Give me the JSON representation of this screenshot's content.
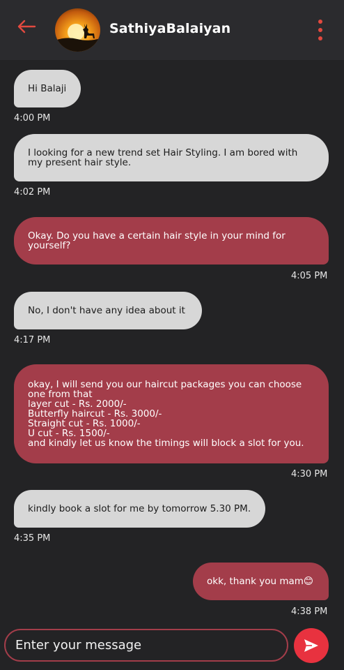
{
  "header": {
    "contact_name": "SathiyaBalaiyan",
    "back_icon": "arrow-left-icon",
    "menu_icon": "more-vertical-icon",
    "accent_color": "#e2493f"
  },
  "messages": [
    {
      "direction": "incoming",
      "text": "Hi Balaji",
      "time": "4:00 PM"
    },
    {
      "direction": "incoming",
      "text": "I looking for a new trend set Hair Styling. I am bored with\nmy present hair style.",
      "time": "4:02 PM"
    },
    {
      "direction": "outgoing",
      "text": "Okay. Do you have a certain hair style in your mind for\nyourself?",
      "time": "4:05 PM"
    },
    {
      "direction": "incoming",
      "text": "No, I don't have any idea about it",
      "time": "4:17 PM"
    },
    {
      "direction": "outgoing",
      "text": "okay, I will send you our haircut packages you can choose\none from that\nlayer cut - Rs. 2000/-\nButterfly haircut - Rs. 3000/-\nStraight cut - Rs. 1000/-\nU cut - Rs. 1500/-\nand kindly let us know the timings will block a slot for you.",
      "time": "4:30 PM"
    },
    {
      "direction": "incoming",
      "text": "kindly book a slot for me by tomorrow 5.30 PM.",
      "time": "4:35 PM"
    },
    {
      "direction": "outgoing",
      "text": "okk, thank you mam😊",
      "time": "4:38 PM"
    }
  ],
  "composer": {
    "placeholder": "Enter your message",
    "send_icon": "send-icon"
  },
  "colors": {
    "incoming_bubble": "#d7d7d7",
    "outgoing_bubble": "#a33d4a",
    "send_button": "#e8323f",
    "background": "#232325"
  }
}
